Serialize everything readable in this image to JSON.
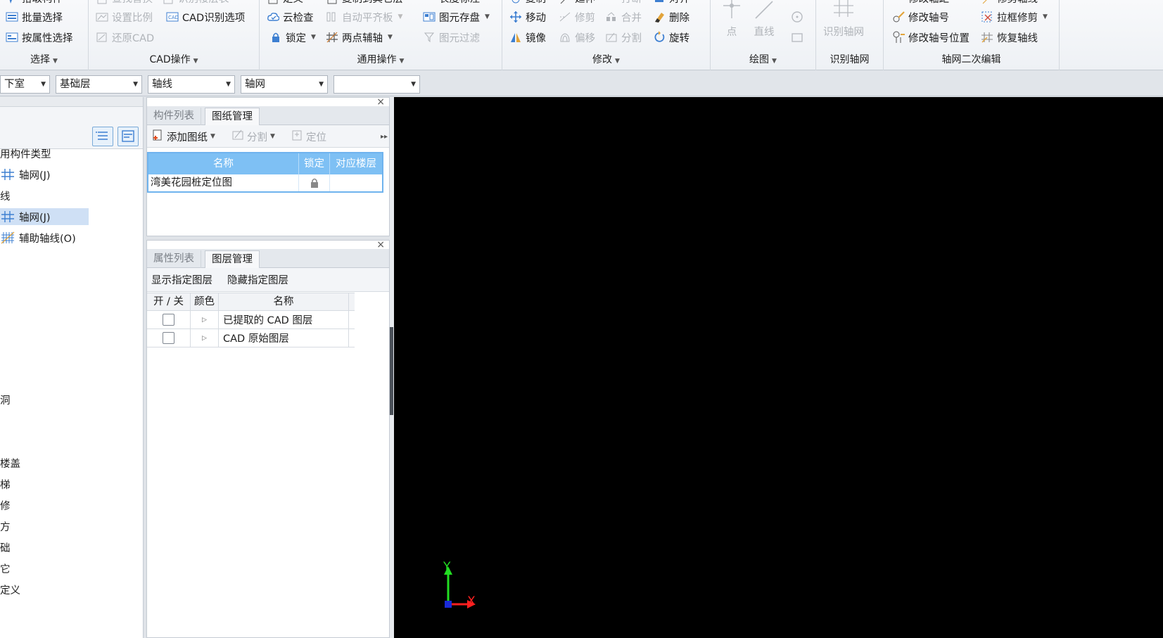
{
  "ribbon": {
    "select": {
      "label": "选择",
      "top_partial": "拾取构件",
      "batch_select": "批量选择",
      "by_attr_select": "按属性选择"
    },
    "cad": {
      "label": "CAD操作",
      "top_partial_1": "查找替换",
      "top_partial_2": "识别楼层表",
      "set_scale": "设置比例",
      "cad_options": "CAD识别选项",
      "restore_cad": "还原CAD"
    },
    "common": {
      "label": "通用操作",
      "top_partial_1": "定义",
      "top_partial_2": "复制到其它层",
      "top_partial_3": "长度标注",
      "cloud_check": "云检查",
      "auto_level": "自动平齐板",
      "elem_save": "图元存盘",
      "lock": "锁定",
      "two_point_aux": "两点辅轴",
      "elem_filter": "图元过滤"
    },
    "modify": {
      "label": "修改",
      "top_partial_1": "复制",
      "top_partial_2": "延伸",
      "top_partial_3": "打断",
      "top_partial_4": "对齐",
      "move": "移动",
      "trim": "修剪",
      "merge": "合并",
      "delete": "删除",
      "mirror": "镜像",
      "offset": "偏移",
      "split": "分割",
      "rotate": "旋转"
    },
    "draw": {
      "label": "绘图",
      "point": "点",
      "line": "直线"
    },
    "recog": {
      "label": "识别轴网",
      "recog_grid": "识别轴网"
    },
    "grid_edit": {
      "label": "轴网二次编辑",
      "top_partial_1": "修改轴距",
      "top_partial_2": "修剪轴线",
      "edit_axis_no": "修改轴号",
      "box_trim": "拉框修剪",
      "edit_axis_no_pos": "修改轴号位置",
      "restore_axis": "恢复轴线"
    }
  },
  "combos": {
    "floor": "下室",
    "layer": "基础层",
    "category": "轴线",
    "type": "轴网",
    "extra": ""
  },
  "tree": {
    "items": [
      "用构件类型",
      "轴网(J)",
      "线",
      "轴网(J)",
      "辅助轴线(O)",
      "洞",
      "楼盖",
      "",
      "",
      "",
      "",
      "",
      "定义"
    ],
    "frag_1": "梯",
    "frag_2": "修",
    "frag_3": "方",
    "frag_4": "础",
    "frag_5": "它"
  },
  "drawing_panel": {
    "tabs": [
      "构件列表",
      "图纸管理"
    ],
    "active_tab": 1,
    "add_drawing": "添加图纸",
    "split": "分割",
    "locate": "定位",
    "columns": [
      "名称",
      "锁定",
      "对应楼层"
    ],
    "rows": [
      {
        "name": "湾美花园桩定位图",
        "floor": ""
      }
    ]
  },
  "layer_panel": {
    "tabs": [
      "属性列表",
      "图层管理"
    ],
    "active_tab": 1,
    "show_layer": "显示指定图层",
    "hide_layer": "隐藏指定图层",
    "columns": [
      "开 / 关",
      "颜色",
      "名称"
    ],
    "rows": [
      {
        "name": "已提取的 CAD 图层"
      },
      {
        "name": "CAD 原始图层"
      }
    ]
  },
  "canvas": {
    "axis_x": "X",
    "axis_y": "Y"
  },
  "colors": {
    "accent_blue": "#7ec0f4",
    "canvas_bg": "#000000",
    "axis_x": "#ff2020",
    "axis_y": "#22dd22"
  }
}
